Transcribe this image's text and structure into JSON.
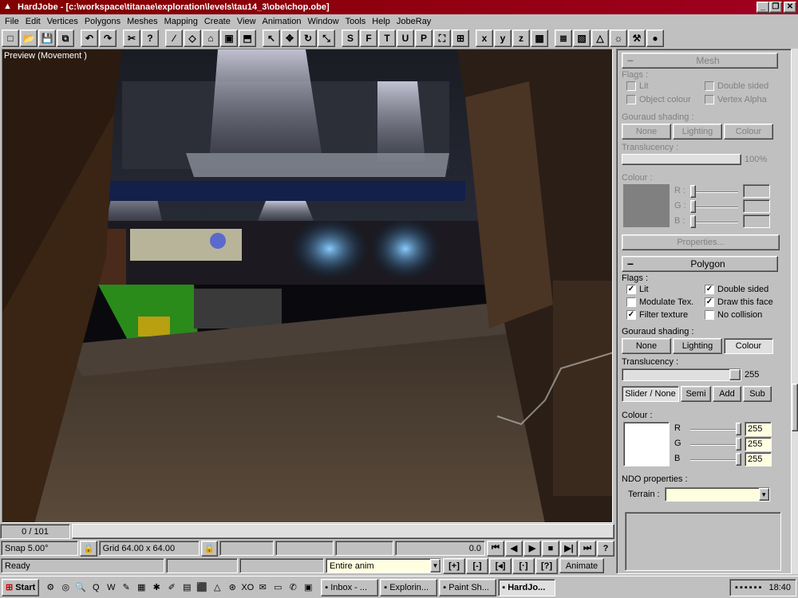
{
  "window": {
    "title": "HardJobe - [c:\\workspace\\titanae\\exploration\\levels\\tau14_3\\obe\\chop.obe]",
    "minimize": "_",
    "restore": "❐",
    "close": "✕"
  },
  "menu": [
    "File",
    "Edit",
    "Vertices",
    "Polygons",
    "Meshes",
    "Mapping",
    "Create",
    "View",
    "Animation",
    "Window",
    "Tools",
    "Help",
    "JobeRay"
  ],
  "toolbar": {
    "icons": [
      "new-file-icon",
      "open-folder-icon",
      "save-icon",
      "save-all-icon",
      "undo-icon",
      "redo-icon",
      "cut-icon",
      "help-icon",
      "draw-polygon-icon",
      "select-face-icon",
      "house-icon",
      "cube-icon",
      "extrude-icon",
      "arrow-cursor-icon",
      "move-icon",
      "rotate-icon",
      "scale-icon",
      "view-s-icon",
      "view-f-icon",
      "view-t-icon",
      "view-u-icon",
      "view-p-icon",
      "zoom-extent-icon",
      "zoom-all-icon",
      "axis-x-icon",
      "axis-y-icon",
      "axis-z-icon",
      "view-grid-icon",
      "notepad-icon",
      "texture-icon",
      "cone-icon",
      "light-bulb-icon",
      "tool-icon",
      "sphere-icon"
    ],
    "glyphs": [
      "□",
      "📂",
      "💾",
      "⧉",
      "↶",
      "↷",
      "✂",
      "?",
      "∕",
      "◇",
      "⌂",
      "▣",
      "⬒",
      "↖",
      "✥",
      "↻",
      "⤡",
      "S",
      "F",
      "T",
      "U",
      "P",
      "⛶",
      "⊞",
      "x",
      "y",
      "z",
      "▦",
      "≣",
      "▧",
      "△",
      "☼",
      "⚒",
      "●"
    ]
  },
  "viewport": {
    "label": "Preview (Movement )"
  },
  "frame": {
    "counter": "0 / 101"
  },
  "controls": {
    "snap": "Snap 5.00°",
    "lock1": "🔒",
    "grid": "Grid 64.00 x 64.00",
    "lock2": "🔒",
    "value": "0.0",
    "playback": [
      "⏮",
      "◀",
      "▶",
      "■",
      "▶|",
      "⏭",
      "?"
    ],
    "anim_icons": [
      "[+]",
      "[-]",
      "[◂]",
      "[·]",
      "[?]"
    ],
    "animate": "Animate"
  },
  "status": {
    "text": "Ready",
    "anim_select": "Entire anim"
  },
  "mesh": {
    "title": "Mesh",
    "toggle": "−",
    "flags_label": "Flags :",
    "flags": [
      {
        "label": "Lit",
        "checked": false
      },
      {
        "label": "Double sided",
        "checked": false
      },
      {
        "label": "Object colour",
        "checked": false
      },
      {
        "label": "Vertex Alpha",
        "checked": false
      }
    ],
    "gouraud_label": "Gouraud shading :",
    "gouraud": [
      "None",
      "Lighting",
      "Colour"
    ],
    "translucency_label": "Translucency :",
    "translucency_value": "100%",
    "colour_label": "Colour :",
    "rgb": [
      {
        "ch": "R :",
        "val": ""
      },
      {
        "ch": "G :",
        "val": ""
      },
      {
        "ch": "B :",
        "val": ""
      }
    ],
    "properties": "Properties..."
  },
  "polygon": {
    "title": "Polygon",
    "toggle": "−",
    "flags_label": "Flags :",
    "flags": [
      {
        "label": "Lit",
        "checked": true
      },
      {
        "label": "Double sided",
        "checked": true
      },
      {
        "label": "Modulate Tex.",
        "checked": false
      },
      {
        "label": "Draw this face",
        "checked": true
      },
      {
        "label": "Filter texture",
        "checked": true
      },
      {
        "label": "No collision",
        "checked": false
      }
    ],
    "gouraud_label": "Gouraud shading :",
    "gouraud": [
      "None",
      "Lighting",
      "Colour"
    ],
    "translucency_label": "Translucency :",
    "translucency_value": "255",
    "blend": [
      "Slider / None",
      "Semi",
      "Add",
      "Sub"
    ],
    "colour_label": "Colour :",
    "colour": "#ffffff",
    "rgb": [
      {
        "ch": "R",
        "val": "255"
      },
      {
        "ch": "G",
        "val": "255"
      },
      {
        "ch": "B",
        "val": "255"
      }
    ],
    "ndo_label": "NDO properties :",
    "terrain_label": "Terrain :",
    "terrain_value": ""
  },
  "taskbar": {
    "start": "Start",
    "quick": [
      "⚙",
      "◎",
      "🔍",
      "Q",
      "W",
      "✎",
      "▦",
      "✱",
      "✐",
      "▤",
      "⬛",
      "△",
      "⊛",
      "XO",
      "✉",
      "▭",
      "✆",
      "▣"
    ],
    "tasks": [
      {
        "label": "Inbox - ..."
      },
      {
        "label": "Explorin..."
      },
      {
        "label": "Paint Sh..."
      },
      {
        "label": "HardJo..."
      }
    ],
    "tray_icons": [
      "📶",
      "🛡",
      "🔊",
      "🖧",
      "🖥",
      "📅"
    ],
    "clock": "18:40"
  }
}
